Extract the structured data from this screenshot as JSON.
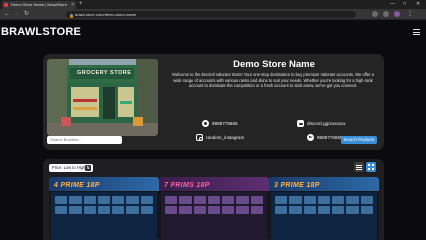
{
  "browser": {
    "tab_title": "Demo Store Name | BrawlStore",
    "url": "brawl-store.com/demo-store-name",
    "window_controls": {
      "minimize": "—",
      "maximize": "□",
      "close": "✕"
    }
  },
  "header": {
    "brand": "BRAWLSTORE",
    "menu_icon": "hamburger-menu-icon"
  },
  "hero": {
    "store_image_sign": "GROCERY STORE",
    "title": "Demo Store Name",
    "description": "Welcome to the Eternal Valorant Store! Your one-stop destination to buy premium Valorant accounts. We offer a wide range of accounts with various ranks and skins to suit your needs. Whether you're looking for a high-rank account to dominate the competition or a fresh account to start anew, we've got you covered.",
    "contacts": {
      "whatsapp": "9988776655",
      "discord": "discord.gg/xxxxxxx",
      "instagram": "random_instagram",
      "telegram": "9988776655"
    }
  },
  "search": {
    "placeholder": "Search Bundles...",
    "button_label": "Search Products"
  },
  "listing": {
    "sort_label": "Price: Low to High",
    "cards": [
      {
        "title": "4 PRIME 18P",
        "title_color": "#ffb347"
      },
      {
        "title": "7 PRIMS 18P",
        "title_color": "#ff5fa8"
      },
      {
        "title": "3 PRIME 18P",
        "title_color": "#ffb347"
      }
    ]
  },
  "colors": {
    "accent": "#3a8fd6",
    "panel": "#242424",
    "background": "#0b0b0d"
  }
}
